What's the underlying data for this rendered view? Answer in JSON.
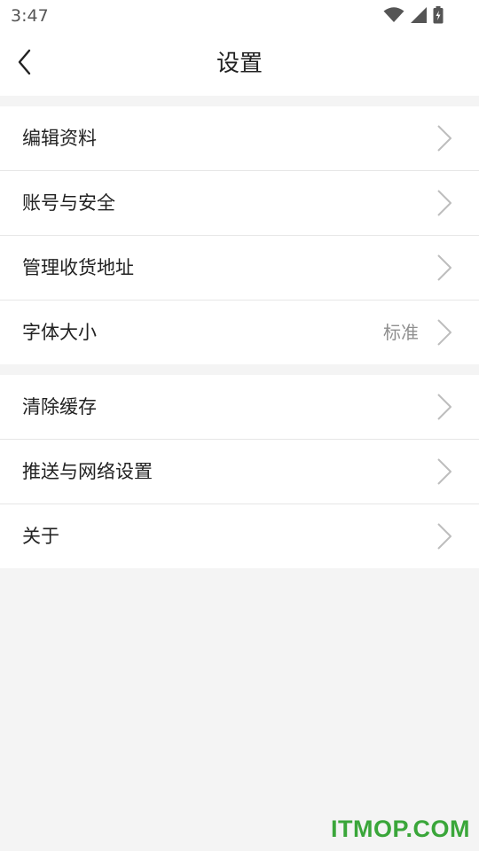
{
  "status_bar": {
    "time": "3:47",
    "icons": [
      "wifi-icon",
      "cellular-signal-icon",
      "battery-charging-icon"
    ]
  },
  "header": {
    "title": "设置",
    "back_icon": "chevron-left-icon"
  },
  "settings_groups": [
    {
      "items": [
        {
          "label": "编辑资料",
          "value": ""
        },
        {
          "label": "账号与安全",
          "value": ""
        },
        {
          "label": "管理收货地址",
          "value": ""
        },
        {
          "label": "字体大小",
          "value": "标准"
        }
      ]
    },
    {
      "items": [
        {
          "label": "清除缓存",
          "value": ""
        },
        {
          "label": "推送与网络设置",
          "value": ""
        },
        {
          "label": "关于",
          "value": ""
        }
      ]
    }
  ],
  "row_icon": "chevron-right-icon",
  "watermark": {
    "text": "ITMOP.COM"
  },
  "colors": {
    "background": "#f4f4f4",
    "surface": "#ffffff",
    "chevron": "#bdbdbd",
    "secondary_text": "#8f8f8f",
    "watermark": "#3aa63a"
  }
}
